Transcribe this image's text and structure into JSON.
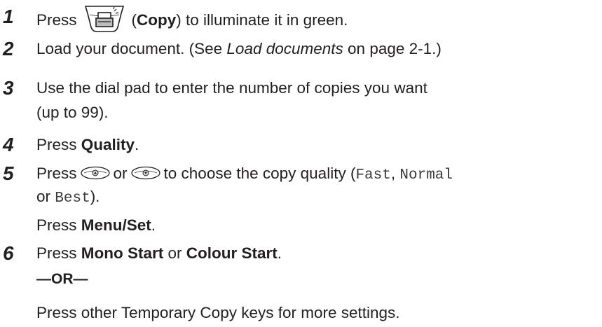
{
  "steps": [
    {
      "num": "1",
      "t1": "Press",
      "t2": "(",
      "t3": "Copy",
      "t4": ") to illuminate it in green."
    },
    {
      "num": "2",
      "t1": "Load your document. (See ",
      "t2": "Load documents",
      "t3": " on page 2-1.)"
    },
    {
      "num": "3",
      "l1": "Use the dial pad to enter the number of copies you want",
      "l2": "(up to 99)."
    },
    {
      "num": "4",
      "t1": "Press ",
      "t2": "Quality",
      "t3": "."
    },
    {
      "num": "5",
      "t1": "Press",
      "t2": "or",
      "t3": "to choose the copy quality (",
      "opt1": "Fast",
      "sep1": ", ",
      "opt2": "Normal",
      "t4": "or ",
      "opt3": "Best",
      "t5": ").",
      "p1": "Press ",
      "p2": "Menu/Set",
      "p3": "."
    },
    {
      "num": "6",
      "t1": "Press ",
      "t2": "Mono Start",
      "t3": " or ",
      "t4": "Colour Start",
      "t5": ".",
      "or": "—OR—",
      "last": "Press other Temporary Copy keys for more settings."
    }
  ],
  "icons": {
    "copy_key": "copy-key-icon",
    "up_key": "up-arrow-key-icon",
    "down_key": "down-arrow-key-icon"
  }
}
